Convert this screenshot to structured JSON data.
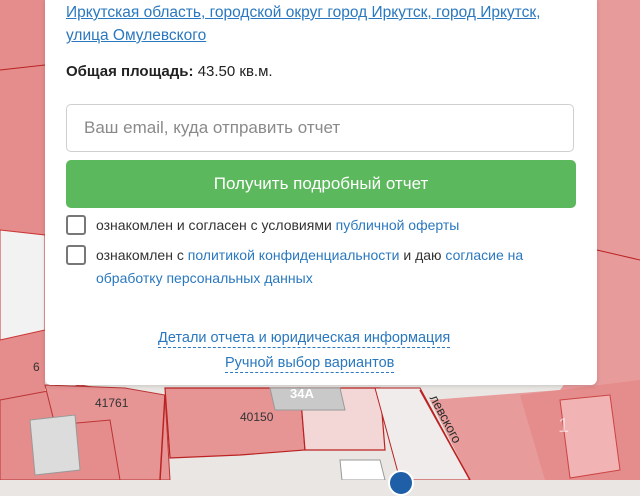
{
  "map": {
    "lots": [
      "41761",
      "40150",
      "6"
    ],
    "house": "34А",
    "street_fragment": "левского",
    "watermark": "1"
  },
  "panel": {
    "address": "Иркутская область, городской округ город Иркутск, город Иркутск, улица Омулевского",
    "area_label": "Общая площадь:",
    "area_value": "43.50 кв.м.",
    "email_placeholder": "Ваш email, куда отправить отчет",
    "email_value": "",
    "submit_label": "Получить подробный отчет",
    "consent1_text": "ознакомлен и согласен с условиями ",
    "consent1_link": "публичной оферты",
    "consent2_text_a": "ознакомлен с ",
    "consent2_link_a": "политикой конфиденциальности",
    "consent2_text_b": " и даю ",
    "consent2_link_b": "согласие на обработку персональных данных",
    "details_link": "Детали отчета и юридическая информация",
    "manual_link": "Ручной выбор вариантов"
  },
  "colors": {
    "accent": "#2a78bf",
    "button": "#5cb85c",
    "map_parcel": "#e58c8c"
  }
}
